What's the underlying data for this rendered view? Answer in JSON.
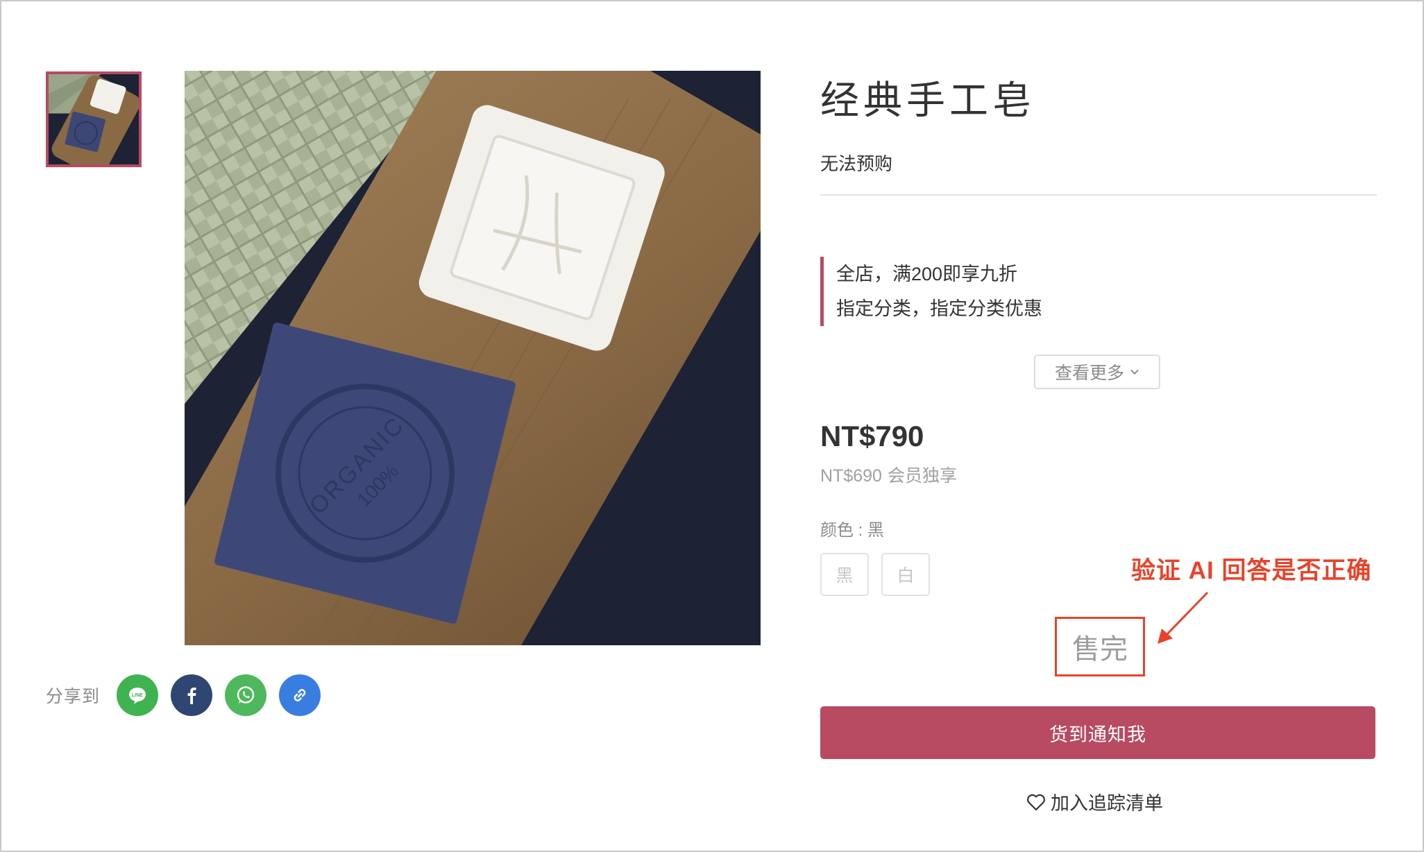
{
  "product": {
    "title": "经典手工皂",
    "preorder_status": "无法预购",
    "price": "NT$790",
    "member_price": "NT$690",
    "member_price_label": "会员独享"
  },
  "promotions": [
    "全店，满200即享九折",
    "指定分类，指定分类优惠"
  ],
  "more_button": {
    "label": "查看更多",
    "icon": "chevron-down-icon"
  },
  "variant": {
    "label": "颜色 : 黑",
    "options": [
      "黑",
      "白"
    ]
  },
  "sold_out": "售完",
  "annotation": "验证 AI 回答是否正确",
  "notify_button": "货到通知我",
  "wishlist_button": {
    "label": "加入追踪清单",
    "icon": "heart-icon"
  },
  "share": {
    "label": "分享到",
    "line_text": "LINE",
    "icons": [
      "line-icon",
      "facebook-icon",
      "whatsapp-icon",
      "link-icon"
    ]
  },
  "image_text": {
    "stamp_main": "ORGANIC",
    "stamp_sub": "100%"
  },
  "colors": {
    "accent": "#b84a62",
    "annotation_red": "#e8432a",
    "line_green": "#3fb34f",
    "facebook_blue": "#2f4672",
    "whatsapp_green": "#4fb85c",
    "link_blue": "#3a7de0"
  }
}
